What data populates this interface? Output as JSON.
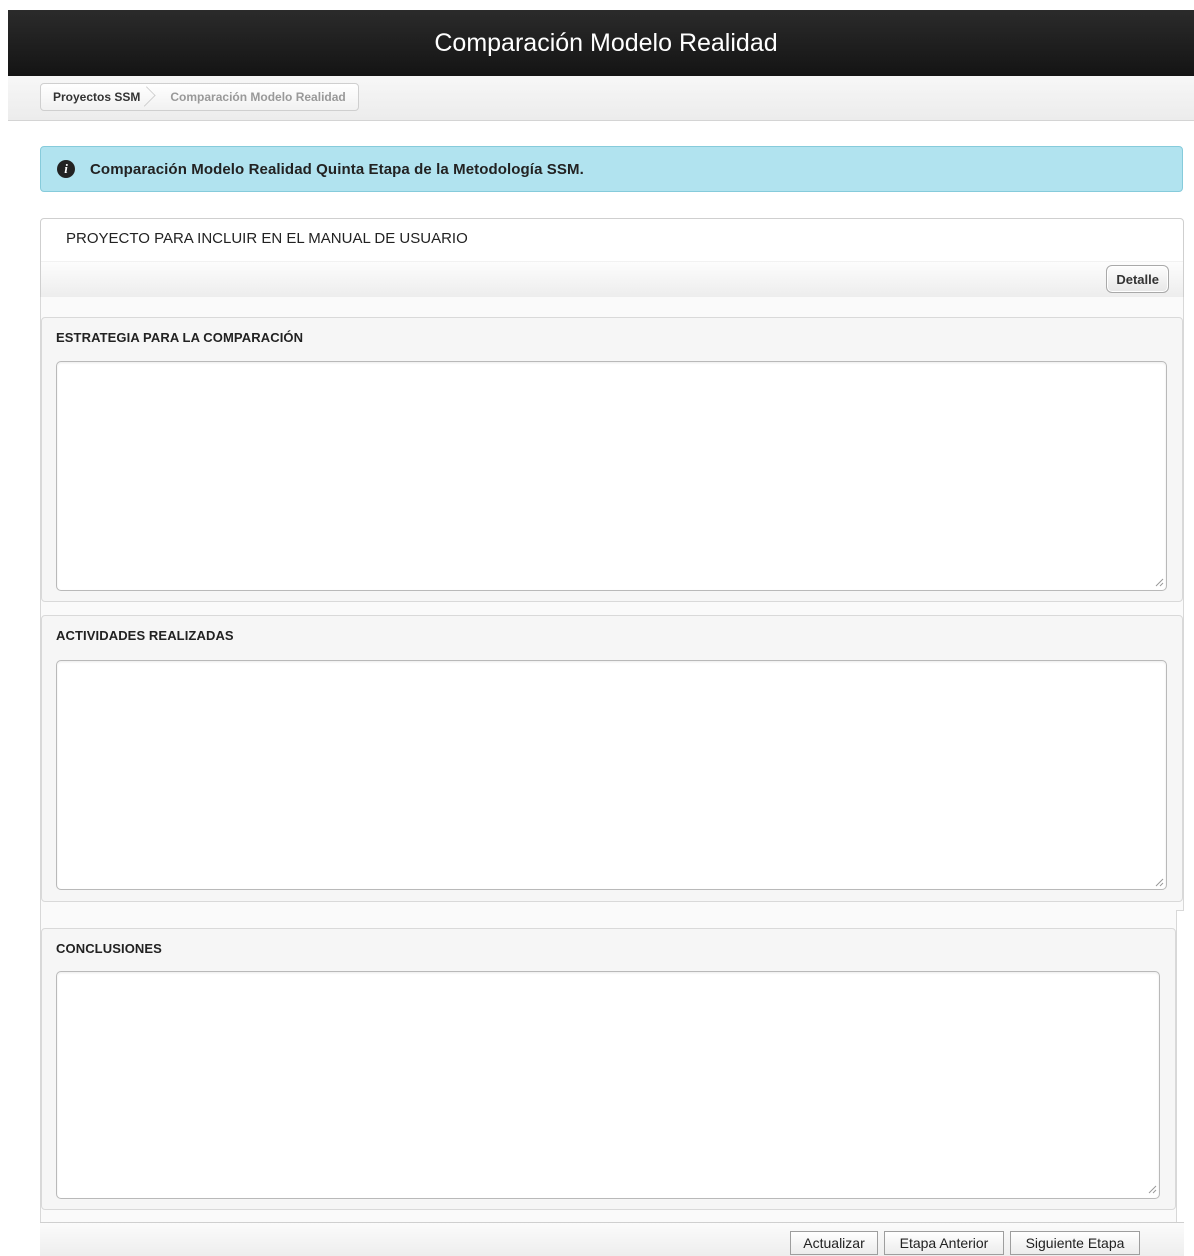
{
  "header": {
    "title": "Comparación Modelo Realidad"
  },
  "breadcrumb": {
    "items": [
      {
        "label": "Proyectos SSM"
      },
      {
        "label": "Comparación Modelo Realidad"
      }
    ]
  },
  "alert": {
    "icon": "info-icon",
    "text": "Comparación Modelo Realidad Quinta Etapa de la Metodología SSM."
  },
  "project": {
    "title": "PROYECTO PARA INCLUIR EN EL MANUAL DE USUARIO",
    "detail_button": "Detalle"
  },
  "sections": {
    "estrategia": {
      "label": "ESTRATEGIA PARA LA COMPARACIÓN",
      "value": ""
    },
    "actividades": {
      "label": "ACTIVIDADES REALIZADAS",
      "value": ""
    },
    "conclusiones": {
      "label": "CONCLUSIONES",
      "value": ""
    }
  },
  "actions": {
    "update": "Actualizar",
    "previous": "Etapa Anterior",
    "next": "Siguiente Etapa"
  },
  "colors": {
    "header_bg": "#1c1c1c",
    "alert_bg": "#b1e3ef",
    "alert_border": "#86cbdb"
  }
}
